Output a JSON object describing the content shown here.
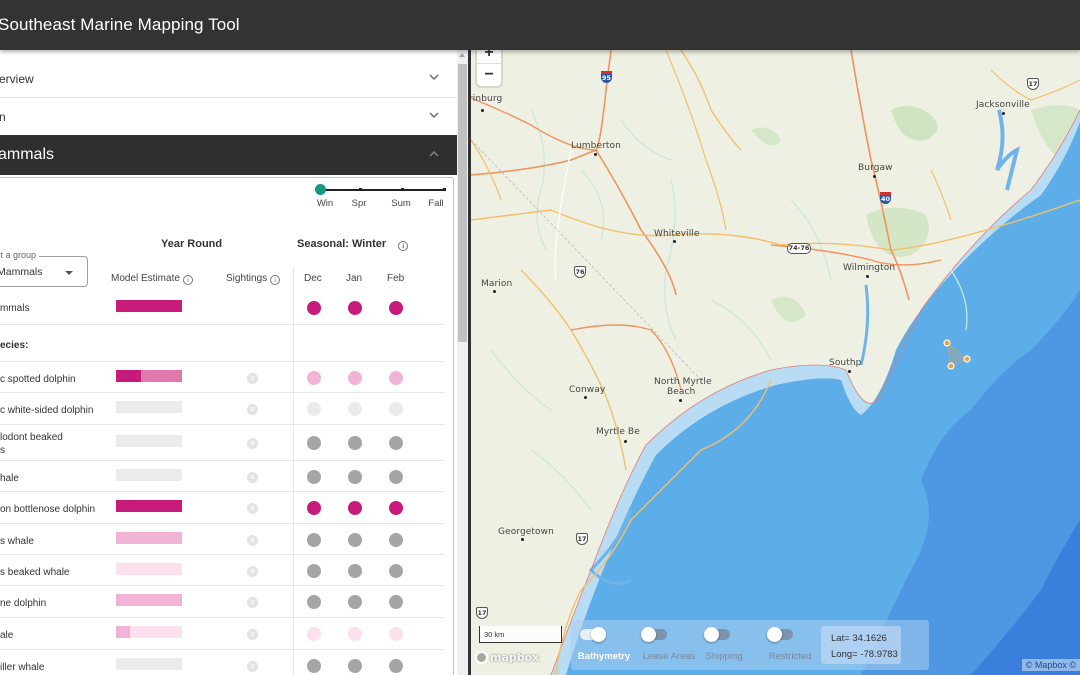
{
  "app": {
    "title": "Southeast Marine Mapping Tool"
  },
  "sidebar": {
    "accordions": [
      {
        "label": "erview",
        "expanded": false
      },
      {
        "label": "n",
        "expanded": false
      },
      {
        "label": "ammals",
        "expanded": true
      }
    ],
    "season_slider": {
      "labels": [
        "Win",
        "Spr",
        "Sum",
        "Fall"
      ],
      "selected": "Win",
      "accent": "#14967f"
    },
    "table": {
      "year_round_header": "Year Round",
      "seasonal_header": "Seasonal: Winter",
      "group_select": {
        "legend": "ct a group",
        "value": "Mammals"
      },
      "model_estimate_label": "Model Estimate",
      "sightings_label": "Sightings",
      "months": [
        "Dec",
        "Jan",
        "Feb"
      ],
      "all_row": {
        "name": "mmals",
        "bar": [
          {
            "fraction": 1.0,
            "color": "#c71b7c"
          }
        ],
        "dots": [
          "#c71b7c",
          "#c71b7c",
          "#c71b7c"
        ]
      },
      "species_heading": "ecies:",
      "species": [
        {
          "name": "c spotted dolphin",
          "bar": [
            {
              "fraction": 0.38,
              "color": "#c71b7c"
            },
            {
              "fraction": 0.62,
              "color": "#de78ad"
            }
          ],
          "sighting": "x",
          "dots": [
            "#f2b4d6",
            "#f2b4d6",
            "#f2b4d6"
          ]
        },
        {
          "name": "c white-sided dolphin",
          "bar": [],
          "sighting": "x",
          "dots": [
            "#ebebeb",
            "#ebebeb",
            "#ebebeb"
          ]
        },
        {
          "name": "lodont beaked\ns",
          "bar": [],
          "sighting": "x",
          "dots": [
            "#a5a5a5",
            "#a5a5a5",
            "#a5a5a5"
          ]
        },
        {
          "name": "hale",
          "bar": [],
          "sighting": "x",
          "dots": [
            "#a5a5a5",
            "#a5a5a5",
            "#a5a5a5"
          ]
        },
        {
          "name": "on bottlenose dolphin",
          "bar": [
            {
              "fraction": 1.0,
              "color": "#c71b7c"
            }
          ],
          "sighting": "x",
          "dots": [
            "#c71b7c",
            "#c71b7c",
            "#c71b7c"
          ]
        },
        {
          "name": "s whale",
          "bar": [
            {
              "fraction": 1.0,
              "color": "#f2b4d6"
            }
          ],
          "sighting": "x",
          "dots": [
            "#a5a5a5",
            "#a5a5a5",
            "#a5a5a5"
          ]
        },
        {
          "name": "s beaked whale",
          "bar": [
            {
              "fraction": 1.0,
              "color": "#fce0ee"
            }
          ],
          "sighting": "x",
          "dots": [
            "#a5a5a5",
            "#a5a5a5",
            "#a5a5a5"
          ]
        },
        {
          "name": "ne dolphin",
          "bar": [
            {
              "fraction": 1.0,
              "color": "#f2b4d6"
            }
          ],
          "sighting": "x",
          "dots": [
            "#a5a5a5",
            "#a5a5a5",
            "#a5a5a5"
          ]
        },
        {
          "name": "ale",
          "bar": [
            {
              "fraction": 0.21,
              "color": "#f2b4d6"
            },
            {
              "fraction": 0.79,
              "color": "#fce0ee"
            }
          ],
          "sighting": "x",
          "dots": [
            "#fce0ee",
            "#fce0ee",
            "#fce0ee"
          ]
        },
        {
          "name": "iller whale",
          "bar": [],
          "sighting": "x",
          "dots": [
            "#a5a5a5",
            "#a5a5a5",
            "#a5a5a5"
          ]
        }
      ]
    }
  },
  "map": {
    "zoom_in": "+",
    "zoom_out": "−",
    "places": [
      {
        "name": "rinburg"
      },
      {
        "name": "Lumberton"
      },
      {
        "name": "Jacksonville"
      },
      {
        "name": "Burgaw"
      },
      {
        "name": "Whiteville"
      },
      {
        "name": "Wilmington"
      },
      {
        "name": "Marion"
      },
      {
        "name": "Southp"
      },
      {
        "name": "Conway"
      },
      {
        "name": "North Myrtle"
      },
      {
        "name": "Beach"
      },
      {
        "name": "Myrtle Be"
      },
      {
        "name": "Georgetown"
      }
    ],
    "shields": [
      "95",
      "17",
      "40",
      "74-76",
      "76",
      "17",
      "17"
    ],
    "scale_label": "30 km",
    "logo": "mapbox",
    "attribution": "© Mapbox ©",
    "layers": [
      {
        "label": "Bathymetry",
        "on": true
      },
      {
        "label": "Lease Areas",
        "on": false
      },
      {
        "label": "Shipping",
        "on": false
      },
      {
        "label": "Restricted",
        "on": false
      }
    ],
    "coords": {
      "lat": "Lat= 34.1626",
      "long": "Long= -78.9783"
    }
  }
}
